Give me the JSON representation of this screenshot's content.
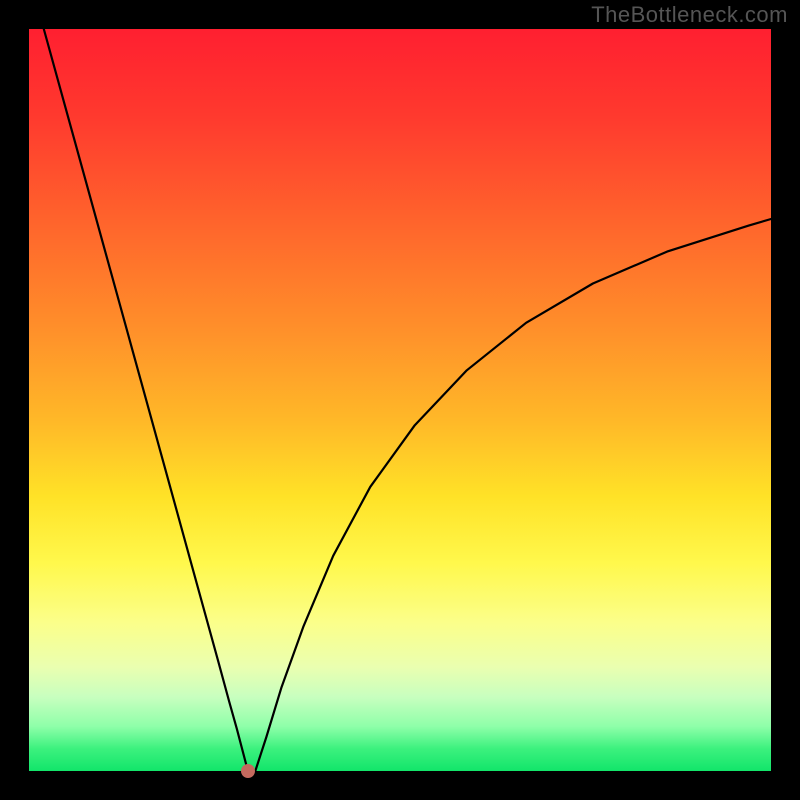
{
  "watermark": "TheBottleneck.com",
  "chart_data": {
    "type": "line",
    "title": "",
    "xlabel": "",
    "ylabel": "",
    "xlim": [
      0,
      1
    ],
    "ylim": [
      0,
      1
    ],
    "min_point": {
      "x": 0.295,
      "y": 0.0
    },
    "series": [
      {
        "name": "bottleneck-curve",
        "x": [
          0.02,
          0.06,
          0.1,
          0.14,
          0.18,
          0.22,
          0.255,
          0.27,
          0.28,
          0.295,
          0.305,
          0.32,
          0.34,
          0.37,
          0.41,
          0.46,
          0.52,
          0.59,
          0.67,
          0.76,
          0.86,
          0.97,
          1.0
        ],
        "y": [
          1.0,
          0.855,
          0.71,
          0.565,
          0.42,
          0.275,
          0.148,
          0.093,
          0.057,
          0.0,
          0.0,
          0.046,
          0.112,
          0.195,
          0.29,
          0.383,
          0.466,
          0.54,
          0.604,
          0.657,
          0.7,
          0.735,
          0.744
        ]
      }
    ],
    "colors": {
      "curve": "#000000",
      "dot": "#c46a5e",
      "gradient_top": "#ff1f30",
      "gradient_bottom": "#12e56a"
    }
  }
}
